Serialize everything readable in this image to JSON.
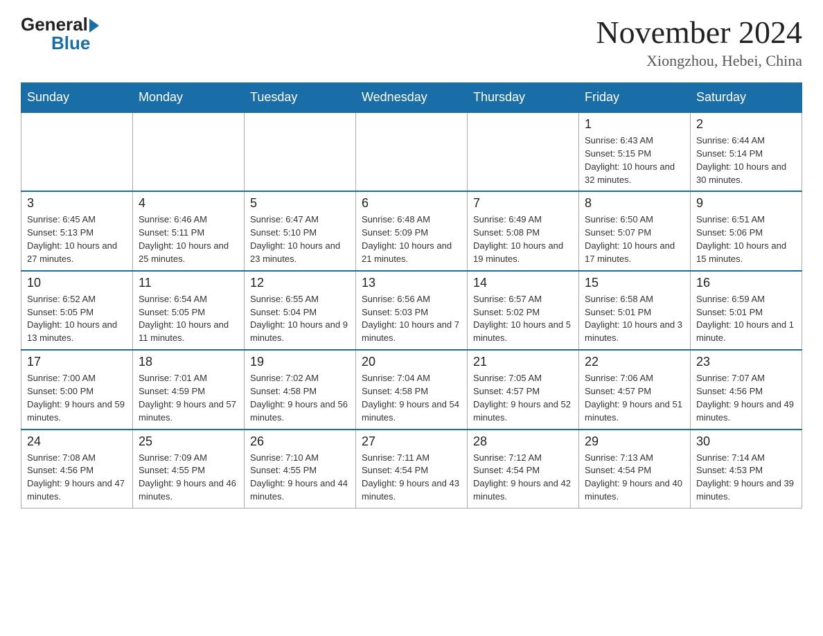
{
  "header": {
    "logo_general": "General",
    "logo_blue": "Blue",
    "month_year": "November 2024",
    "location": "Xiongzhou, Hebei, China"
  },
  "weekdays": [
    "Sunday",
    "Monday",
    "Tuesday",
    "Wednesday",
    "Thursday",
    "Friday",
    "Saturday"
  ],
  "weeks": [
    [
      {
        "day": "",
        "info": ""
      },
      {
        "day": "",
        "info": ""
      },
      {
        "day": "",
        "info": ""
      },
      {
        "day": "",
        "info": ""
      },
      {
        "day": "",
        "info": ""
      },
      {
        "day": "1",
        "info": "Sunrise: 6:43 AM\nSunset: 5:15 PM\nDaylight: 10 hours and 32 minutes."
      },
      {
        "day": "2",
        "info": "Sunrise: 6:44 AM\nSunset: 5:14 PM\nDaylight: 10 hours and 30 minutes."
      }
    ],
    [
      {
        "day": "3",
        "info": "Sunrise: 6:45 AM\nSunset: 5:13 PM\nDaylight: 10 hours and 27 minutes."
      },
      {
        "day": "4",
        "info": "Sunrise: 6:46 AM\nSunset: 5:11 PM\nDaylight: 10 hours and 25 minutes."
      },
      {
        "day": "5",
        "info": "Sunrise: 6:47 AM\nSunset: 5:10 PM\nDaylight: 10 hours and 23 minutes."
      },
      {
        "day": "6",
        "info": "Sunrise: 6:48 AM\nSunset: 5:09 PM\nDaylight: 10 hours and 21 minutes."
      },
      {
        "day": "7",
        "info": "Sunrise: 6:49 AM\nSunset: 5:08 PM\nDaylight: 10 hours and 19 minutes."
      },
      {
        "day": "8",
        "info": "Sunrise: 6:50 AM\nSunset: 5:07 PM\nDaylight: 10 hours and 17 minutes."
      },
      {
        "day": "9",
        "info": "Sunrise: 6:51 AM\nSunset: 5:06 PM\nDaylight: 10 hours and 15 minutes."
      }
    ],
    [
      {
        "day": "10",
        "info": "Sunrise: 6:52 AM\nSunset: 5:05 PM\nDaylight: 10 hours and 13 minutes."
      },
      {
        "day": "11",
        "info": "Sunrise: 6:54 AM\nSunset: 5:05 PM\nDaylight: 10 hours and 11 minutes."
      },
      {
        "day": "12",
        "info": "Sunrise: 6:55 AM\nSunset: 5:04 PM\nDaylight: 10 hours and 9 minutes."
      },
      {
        "day": "13",
        "info": "Sunrise: 6:56 AM\nSunset: 5:03 PM\nDaylight: 10 hours and 7 minutes."
      },
      {
        "day": "14",
        "info": "Sunrise: 6:57 AM\nSunset: 5:02 PM\nDaylight: 10 hours and 5 minutes."
      },
      {
        "day": "15",
        "info": "Sunrise: 6:58 AM\nSunset: 5:01 PM\nDaylight: 10 hours and 3 minutes."
      },
      {
        "day": "16",
        "info": "Sunrise: 6:59 AM\nSunset: 5:01 PM\nDaylight: 10 hours and 1 minute."
      }
    ],
    [
      {
        "day": "17",
        "info": "Sunrise: 7:00 AM\nSunset: 5:00 PM\nDaylight: 9 hours and 59 minutes."
      },
      {
        "day": "18",
        "info": "Sunrise: 7:01 AM\nSunset: 4:59 PM\nDaylight: 9 hours and 57 minutes."
      },
      {
        "day": "19",
        "info": "Sunrise: 7:02 AM\nSunset: 4:58 PM\nDaylight: 9 hours and 56 minutes."
      },
      {
        "day": "20",
        "info": "Sunrise: 7:04 AM\nSunset: 4:58 PM\nDaylight: 9 hours and 54 minutes."
      },
      {
        "day": "21",
        "info": "Sunrise: 7:05 AM\nSunset: 4:57 PM\nDaylight: 9 hours and 52 minutes."
      },
      {
        "day": "22",
        "info": "Sunrise: 7:06 AM\nSunset: 4:57 PM\nDaylight: 9 hours and 51 minutes."
      },
      {
        "day": "23",
        "info": "Sunrise: 7:07 AM\nSunset: 4:56 PM\nDaylight: 9 hours and 49 minutes."
      }
    ],
    [
      {
        "day": "24",
        "info": "Sunrise: 7:08 AM\nSunset: 4:56 PM\nDaylight: 9 hours and 47 minutes."
      },
      {
        "day": "25",
        "info": "Sunrise: 7:09 AM\nSunset: 4:55 PM\nDaylight: 9 hours and 46 minutes."
      },
      {
        "day": "26",
        "info": "Sunrise: 7:10 AM\nSunset: 4:55 PM\nDaylight: 9 hours and 44 minutes."
      },
      {
        "day": "27",
        "info": "Sunrise: 7:11 AM\nSunset: 4:54 PM\nDaylight: 9 hours and 43 minutes."
      },
      {
        "day": "28",
        "info": "Sunrise: 7:12 AM\nSunset: 4:54 PM\nDaylight: 9 hours and 42 minutes."
      },
      {
        "day": "29",
        "info": "Sunrise: 7:13 AM\nSunset: 4:54 PM\nDaylight: 9 hours and 40 minutes."
      },
      {
        "day": "30",
        "info": "Sunrise: 7:14 AM\nSunset: 4:53 PM\nDaylight: 9 hours and 39 minutes."
      }
    ]
  ]
}
